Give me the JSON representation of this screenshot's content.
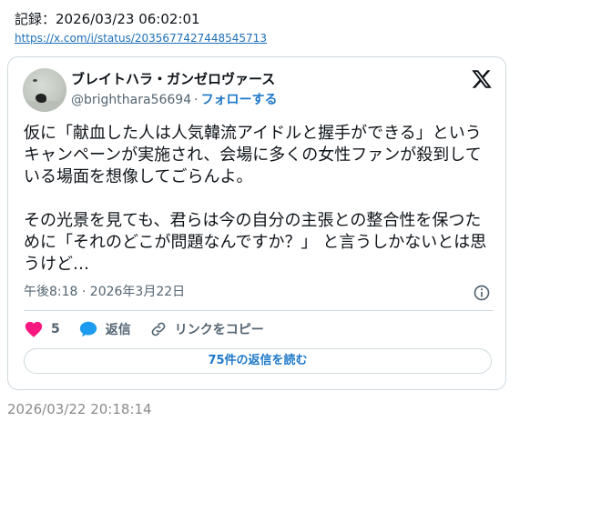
{
  "header": {
    "record_label": "記録：2026/03/23 06:02:01",
    "source_url": "https://x.com/i/status/2035677427448545713"
  },
  "tweet": {
    "display_name": "ブレイトハラ・ガンゼロヴァース",
    "handle": "@brighthara56694",
    "separator": "·",
    "follow_label": "フォローする",
    "text": "仮に「献血した人は人気韓流アイドルと握手ができる」というキャンペーンが実施され、会場に多くの女性ファンが殺到している場面を想像してごらんよ。\n\nその光景を見ても、君らは今の自分の主張との整合性を保つために「それのどこが問題なんですか？」 と言うしかないとは思うけど…",
    "timestamp": "午後8:18 · 2026年3月22日",
    "like_count": "5",
    "reply_label": "返信",
    "copy_link_label": "リンクをコピー",
    "read_replies_label": "75件の返信を読む"
  },
  "footer": {
    "date": "2026/03/22 20:18:14"
  },
  "colors": {
    "like": "#f91880",
    "reply": "#1d9bf0",
    "link": "#1d78c8",
    "muted": "#536471"
  },
  "icons": {
    "brand": "x-logo-icon",
    "info": "info-icon",
    "like": "heart-icon",
    "reply": "speech-bubble-icon",
    "copy_link": "link-icon"
  }
}
